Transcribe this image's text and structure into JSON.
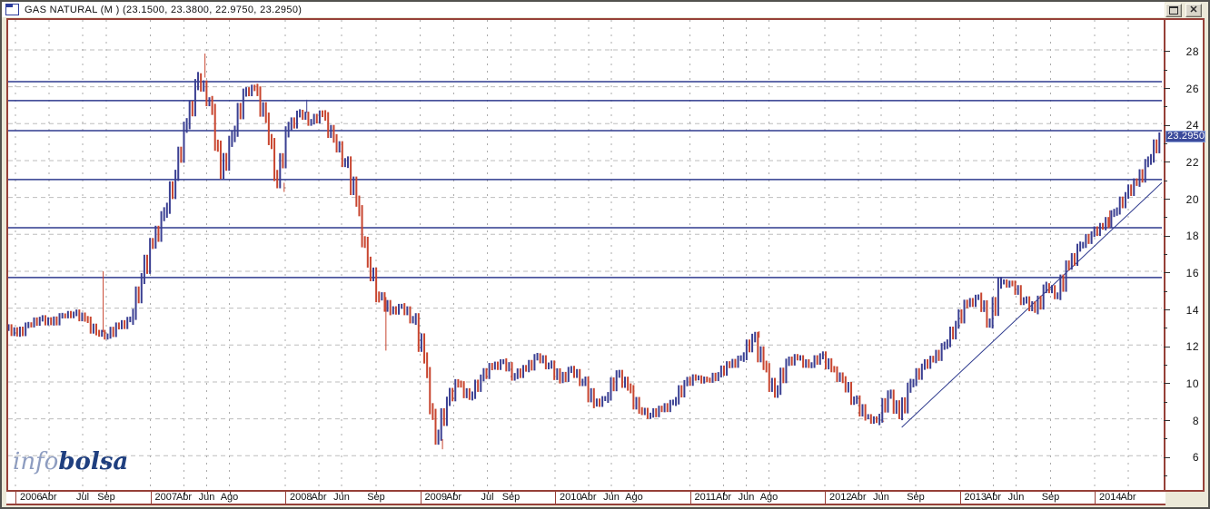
{
  "window": {
    "title": "GAS NATURAL (M ) (23.1500, 23.3800, 22.9750, 23.2950)",
    "buttons": [
      {
        "name": "restore-button",
        "icon": "restore-icon"
      },
      {
        "name": "close-button",
        "icon": "close-icon"
      }
    ]
  },
  "logo": {
    "part1": "info",
    "part2": "bolsa"
  },
  "price_label": {
    "value": "23.2950"
  },
  "colors": {
    "up_bar": "#3a3f92",
    "down_bar": "#c8452f",
    "level_line": "#2e3a8e",
    "trend_line": "#2e3a8e",
    "grid": "#bdbdbd",
    "grid_vertical": "#ababab",
    "frame": "#964038",
    "price_label_bg": "#3b4a9b",
    "background": "#ece9d8",
    "plot_bg": "#ffffff"
  },
  "chart_data": {
    "type": "bar",
    "subtype": "ohlc-weekly-bars",
    "title": "GAS NATURAL (M )",
    "last_ohlc": {
      "open": "23.1500",
      "high": "23.3800",
      "low": "22.9750",
      "close": "23.2950"
    },
    "y_axis": {
      "labeled_ticks": [
        28,
        26,
        24,
        22,
        20,
        18,
        16,
        14,
        12,
        10,
        8,
        6
      ],
      "minor_ticks": [
        27,
        25,
        23,
        21,
        19,
        17,
        15,
        13,
        11,
        9,
        7,
        5
      ],
      "visible_range": [
        4.2,
        29.5
      ],
      "grid": "dashed"
    },
    "x_axis": {
      "years": [
        {
          "label": "2006",
          "months": [
            "Abr",
            "Jul",
            "Sep"
          ]
        },
        {
          "label": "2007",
          "months": [
            "Abr",
            "Jun",
            "Ago"
          ]
        },
        {
          "label": "2008",
          "months": [
            "Abr",
            "Jun",
            "Sep"
          ]
        },
        {
          "label": "2009",
          "months": [
            "Abr",
            "Jul",
            "Sep"
          ]
        },
        {
          "label": "2010",
          "months": [
            "Abr",
            "Jun",
            "Ago"
          ]
        },
        {
          "label": "2011",
          "months": [
            "Abr",
            "Jun",
            "Ago"
          ]
        },
        {
          "label": "2012",
          "months": [
            "Abr",
            "Jun",
            "Sep"
          ]
        },
        {
          "label": "2013",
          "months": [
            "Abr",
            "Jun",
            "Sep"
          ]
        },
        {
          "label": "2014",
          "months": [
            "Abr"
          ]
        }
      ]
    },
    "support_resistance_levels": [
      26.28,
      25.25,
      23.62,
      20.97,
      18.36,
      15.66
    ],
    "trendline": {
      "start_year_frac": 2012.57,
      "start_price": 7.54,
      "end_year_frac": 2014.52,
      "end_price": 20.95
    },
    "series": {
      "start": "2006-01",
      "interval": "monthly",
      "closes": [
        12.9,
        12.6,
        13.1,
        13.4,
        13.2,
        13.6,
        13.7,
        13.4,
        12.7,
        12.5,
        13.0,
        13.4,
        15.6,
        17.5,
        19.2,
        21.2,
        24.0,
        26.5,
        25.2,
        21.3,
        23.3,
        25.6,
        25.9,
        24.3,
        20.8,
        23.8,
        24.6,
        24.1,
        24.5,
        23.2,
        21.9,
        19.8,
        16.5,
        14.6,
        13.8,
        14.1,
        13.4,
        11.3,
        6.9,
        8.9,
        9.9,
        9.2,
        10.2,
        10.8,
        11.1,
        10.3,
        10.7,
        11.4,
        10.9,
        10.1,
        10.7,
        10.0,
        8.8,
        9.1,
        10.4,
        9.7,
        8.5,
        8.2,
        8.5,
        8.9,
        9.9,
        10.2,
        10.1,
        10.4,
        10.9,
        11.3,
        12.4,
        10.9,
        9.4,
        11.0,
        11.3,
        10.9,
        11.4,
        10.7,
        10.1,
        9.0,
        8.1,
        7.9,
        9.3,
        8.2,
        9.9,
        10.8,
        11.2,
        12.0,
        13.1,
        14.2,
        14.6,
        13.2,
        15.4,
        15.3,
        14.4,
        13.9,
        15.2,
        14.7,
        16.3,
        17.4,
        18.0,
        18.4,
        19.2,
        20.1,
        20.8,
        22.0,
        23.295
      ]
    },
    "wick_extremes": [
      {
        "index": 8,
        "high": 16.0,
        "color": "down"
      },
      {
        "index": 17,
        "high": 27.8,
        "color": "down"
      },
      {
        "index": 24,
        "low": 20.3,
        "color": "down"
      },
      {
        "index": 26,
        "high": 25.3,
        "color": "up"
      },
      {
        "index": 33,
        "low": 11.7,
        "color": "down"
      },
      {
        "index": 38,
        "low": 6.35,
        "color": "down"
      },
      {
        "index": 66,
        "high": 12.75,
        "color": "down"
      },
      {
        "index": 77,
        "low": 7.85,
        "color": "down"
      },
      {
        "index": 97,
        "high": 19.3,
        "color": "down"
      },
      {
        "index": 102,
        "high": 23.38,
        "low": 22.95,
        "color": "up"
      }
    ]
  }
}
